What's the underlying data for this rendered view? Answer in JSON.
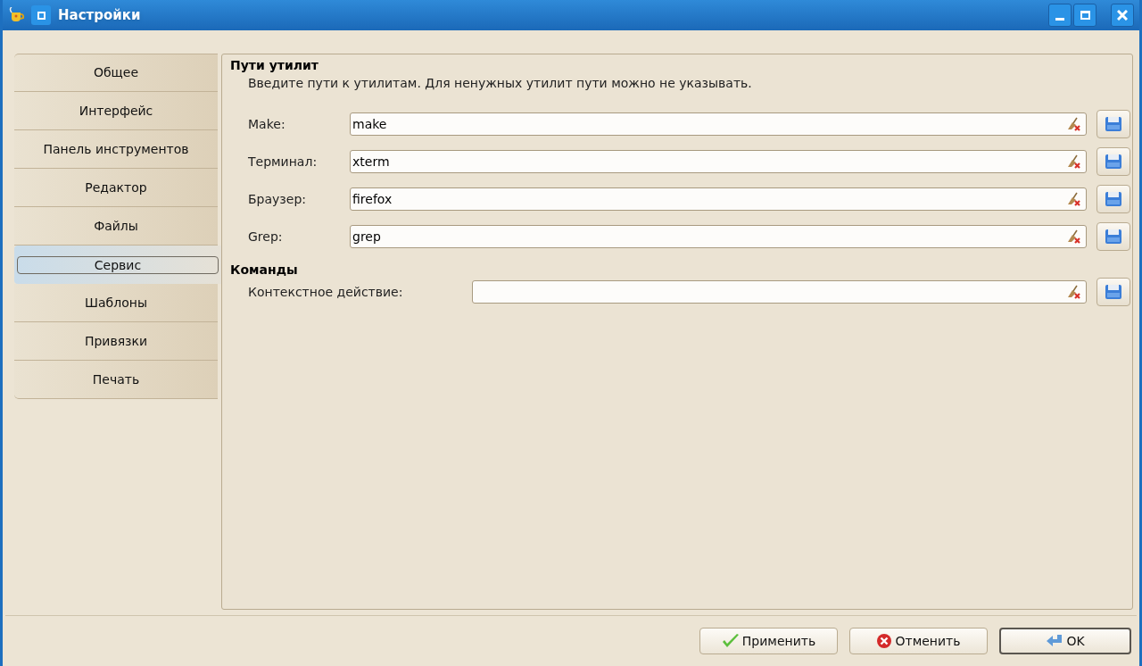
{
  "window": {
    "title": "Настройки"
  },
  "sidebar": {
    "items": [
      {
        "label": "Общее",
        "selected": false
      },
      {
        "label": "Интерфейс",
        "selected": false
      },
      {
        "label": "Панель инструментов",
        "selected": false
      },
      {
        "label": "Редактор",
        "selected": false
      },
      {
        "label": "Файлы",
        "selected": false
      },
      {
        "label": "Сервис",
        "selected": true
      },
      {
        "label": "Шаблоны",
        "selected": false
      },
      {
        "label": "Привязки",
        "selected": false
      },
      {
        "label": "Печать",
        "selected": false
      }
    ]
  },
  "sections": [
    {
      "heading": "Пути утилит",
      "description": "Введите пути к утилитам. Для ненужных утилит пути можно не указывать.",
      "fields": [
        {
          "label": "Make:",
          "value": "make"
        },
        {
          "label": "Терминал:",
          "value": "xterm"
        },
        {
          "label": "Браузер:",
          "value": "firefox"
        },
        {
          "label": "Grep:",
          "value": "grep"
        }
      ]
    },
    {
      "heading": "Команды",
      "fields": [
        {
          "label": "Контекстное действие:"
        }
      ]
    }
  ],
  "buttons": [
    {
      "kind": "apply",
      "label": "Применить"
    },
    {
      "kind": "cancel",
      "label": "Отменить"
    },
    {
      "kind": "ok",
      "label": "OK"
    }
  ]
}
